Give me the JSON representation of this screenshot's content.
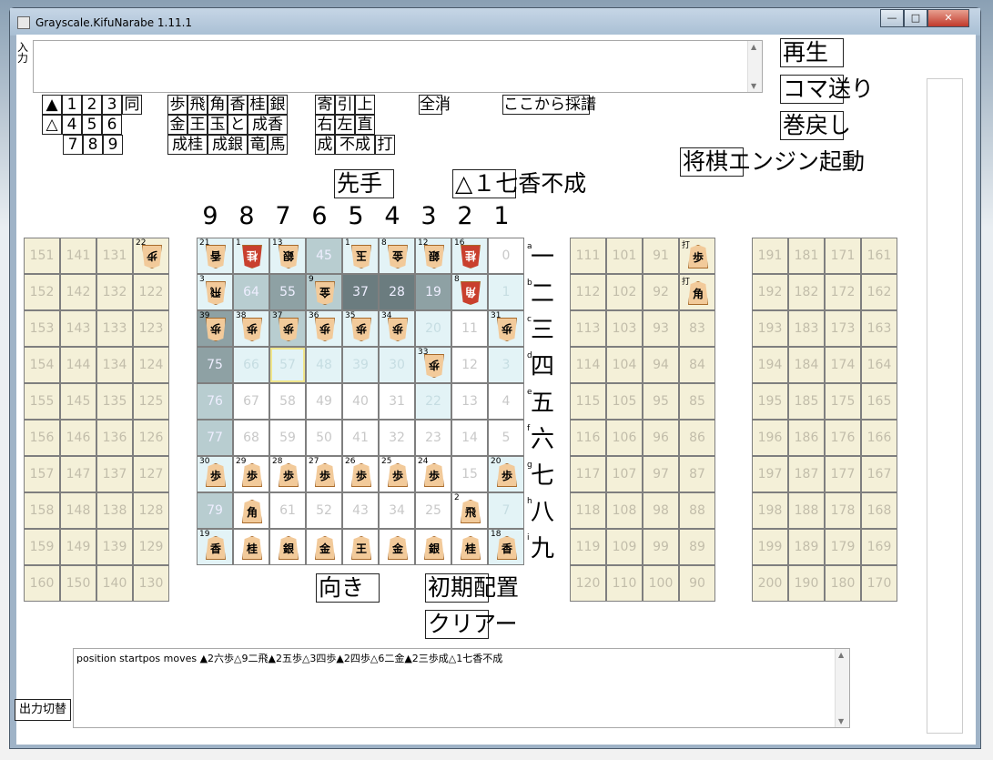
{
  "window": {
    "title": "Grayscale.KifuNarabe 1.11.1",
    "min": "—",
    "max": "□",
    "close": "✕"
  },
  "input": {
    "label": "入力",
    "value": ""
  },
  "buttons": {
    "play": "再生",
    "step": "コマ送り",
    "rewind": "巻戻し",
    "engine": "将棋エンジン起動",
    "turn": "先手",
    "move": "△１七香不成",
    "orient": "向き",
    "init": "初期配置",
    "clear": "クリアー",
    "output": "出力切替"
  },
  "keys": {
    "a": [
      "▲",
      "1",
      "2",
      "3",
      "同"
    ],
    "b": [
      "△",
      "4",
      "5",
      "6"
    ],
    "c": [
      "7",
      "8",
      "9"
    ],
    "p1": [
      "歩",
      "飛",
      "角",
      "香",
      "桂",
      "銀"
    ],
    "p2": [
      "金",
      "王",
      "玉",
      "と",
      "成香"
    ],
    "p3": [
      "成桂",
      "成銀",
      "竜",
      "馬"
    ],
    "m1": [
      "寄",
      "引",
      "上"
    ],
    "m2": [
      "右",
      "左",
      "直"
    ],
    "m3": [
      "成",
      "不成",
      "打"
    ],
    "alldel": "全消",
    "fromhere": "ここから採譜"
  },
  "columns": [
    "9",
    "8",
    "7",
    "6",
    "5",
    "4",
    "3",
    "2",
    "1"
  ],
  "rows": [
    "一",
    "二",
    "三",
    "四",
    "五",
    "六",
    "七",
    "八",
    "九"
  ],
  "rowsmall": [
    "a",
    "b",
    "c",
    "d",
    "e",
    "f",
    "g",
    "h",
    "i"
  ],
  "board": [
    [
      {
        "n": "21",
        "p": "香",
        "g": 1
      },
      {
        "n": "1",
        "p": "桂",
        "g": 1,
        "r": 1
      },
      {
        "n": "13",
        "p": "銀",
        "g": 1
      },
      {
        "n": "45"
      },
      {
        "n": "1",
        "p": "玉",
        "g": 1
      },
      {
        "n": "8",
        "p": "金",
        "g": 1
      },
      {
        "n": "12",
        "p": "銀",
        "g": 1
      },
      {
        "n": "16",
        "p": "桂",
        "g": 1,
        "r": 1
      },
      {
        "n": "0"
      }
    ],
    [
      {
        "n": "3",
        "p": "飛",
        "g": 1
      },
      {
        "n": "64"
      },
      {
        "n": "55"
      },
      {
        "n": "9",
        "p": "金",
        "g": 1
      },
      {
        "n": "37"
      },
      {
        "n": "28"
      },
      {
        "n": "19"
      },
      {
        "n": "8",
        "p": "角",
        "g": 1,
        "r": 1
      },
      {
        "n": "1"
      }
    ],
    [
      {
        "n": "39",
        "p": "歩",
        "g": 1
      },
      {
        "n": "38",
        "p": "歩",
        "g": 1
      },
      {
        "n": "37",
        "p": "歩",
        "g": 1
      },
      {
        "n": "36",
        "p": "歩",
        "g": 1
      },
      {
        "n": "35",
        "p": "歩",
        "g": 1
      },
      {
        "n": "34",
        "p": "歩",
        "g": 1
      },
      {
        "n": "20"
      },
      {
        "n": "11"
      },
      {
        "n": "31",
        "p": "歩",
        "g": 1
      }
    ],
    [
      {
        "n": "75"
      },
      {
        "n": "66"
      },
      {
        "n": "57"
      },
      {
        "n": "48"
      },
      {
        "n": "39"
      },
      {
        "n": "30"
      },
      {
        "n": "33",
        "p": "歩",
        "g": 1
      },
      {
        "n": "12"
      },
      {
        "n": "3"
      }
    ],
    [
      {
        "n": "76"
      },
      {
        "n": "67"
      },
      {
        "n": "58"
      },
      {
        "n": "49"
      },
      {
        "n": "40"
      },
      {
        "n": "31"
      },
      {
        "n": "22"
      },
      {
        "n": "13"
      },
      {
        "n": "4"
      }
    ],
    [
      {
        "n": "77"
      },
      {
        "n": "68"
      },
      {
        "n": "59"
      },
      {
        "n": "50"
      },
      {
        "n": "41"
      },
      {
        "n": "32"
      },
      {
        "n": "23"
      },
      {
        "n": "14"
      },
      {
        "n": "5"
      }
    ],
    [
      {
        "n": "30",
        "p": "歩"
      },
      {
        "n": "29",
        "p": "歩"
      },
      {
        "n": "28",
        "p": "歩"
      },
      {
        "n": "27",
        "p": "歩"
      },
      {
        "n": "26",
        "p": "歩"
      },
      {
        "n": "25",
        "p": "歩"
      },
      {
        "n": "24",
        "p": "歩"
      },
      {
        "n": "15"
      },
      {
        "n": "20",
        "p": "歩"
      }
    ],
    [
      {
        "n": "79"
      },
      {
        "n": "",
        "p": "角"
      },
      {
        "n": "61"
      },
      {
        "n": "52"
      },
      {
        "n": "43"
      },
      {
        "n": "34"
      },
      {
        "n": "25"
      },
      {
        "n": "2",
        "p": "飛"
      },
      {
        "n": "7"
      }
    ],
    [
      {
        "n": "19",
        "p": "香"
      },
      {
        "n": "",
        "p": "桂"
      },
      {
        "n": "",
        "p": "銀"
      },
      {
        "n": "",
        "p": "金"
      },
      {
        "n": "",
        "p": "王"
      },
      {
        "n": "",
        "p": "金"
      },
      {
        "n": "",
        "p": "銀"
      },
      {
        "n": "",
        "p": "桂"
      },
      {
        "n": "18",
        "p": "香"
      }
    ]
  ],
  "shade": [
    [
      "d1",
      "d1",
      "d1",
      "d2",
      "d1",
      "d1",
      "d1",
      "red",
      "d0"
    ],
    [
      "d1",
      "d2",
      "d3",
      "d2",
      "d4",
      "d4",
      "d3",
      "d1",
      "d1"
    ],
    [
      "d3",
      "d1",
      "d2",
      "d1",
      "d1",
      "d1",
      "d1",
      "d0",
      "d1"
    ],
    [
      "d3",
      "d1",
      "d1",
      "d1",
      "d1",
      "d1",
      "d1",
      "d0",
      "d1"
    ],
    [
      "d2",
      "d0",
      "d0",
      "d0",
      "d0",
      "d0",
      "d1",
      "d0",
      "d0"
    ],
    [
      "d2",
      "d0",
      "d0",
      "d0",
      "d0",
      "d0",
      "d0",
      "d0",
      "d0"
    ],
    [
      "d1",
      "d0",
      "d0",
      "d0",
      "d0",
      "d0",
      "d0",
      "d0",
      "d1"
    ],
    [
      "d2",
      "d0",
      "d0",
      "d0",
      "d0",
      "d0",
      "d0",
      "d0",
      "d1"
    ],
    [
      "d1",
      "d0",
      "d0",
      "d0",
      "d0",
      "d0",
      "d0",
      "d0",
      "d1"
    ]
  ],
  "leftStand": [
    [
      "151",
      "141",
      "131",
      "22"
    ],
    [
      "152",
      "142",
      "132",
      "122"
    ],
    [
      "153",
      "143",
      "133",
      "123"
    ],
    [
      "154",
      "144",
      "134",
      "124"
    ],
    [
      "155",
      "145",
      "135",
      "125"
    ],
    [
      "156",
      "146",
      "136",
      "126"
    ],
    [
      "157",
      "147",
      "137",
      "127"
    ],
    [
      "158",
      "148",
      "138",
      "128"
    ],
    [
      "159",
      "149",
      "139",
      "129"
    ],
    [
      "160",
      "150",
      "140",
      "130"
    ]
  ],
  "rightStand1": [
    [
      "111",
      "101",
      "91",
      "打"
    ],
    [
      "112",
      "102",
      "92",
      "打"
    ],
    [
      "113",
      "103",
      "93",
      "83"
    ],
    [
      "114",
      "104",
      "94",
      "84"
    ],
    [
      "115",
      "105",
      "95",
      "85"
    ],
    [
      "116",
      "106",
      "96",
      "86"
    ],
    [
      "117",
      "107",
      "97",
      "87"
    ],
    [
      "118",
      "108",
      "98",
      "88"
    ],
    [
      "119",
      "109",
      "99",
      "89"
    ],
    [
      "120",
      "110",
      "100",
      "90"
    ]
  ],
  "rightStand2": [
    [
      "191",
      "181",
      "171",
      "161"
    ],
    [
      "192",
      "182",
      "172",
      "162"
    ],
    [
      "193",
      "183",
      "173",
      "163"
    ],
    [
      "194",
      "184",
      "174",
      "164"
    ],
    [
      "195",
      "185",
      "175",
      "165"
    ],
    [
      "196",
      "186",
      "176",
      "166"
    ],
    [
      "197",
      "187",
      "177",
      "167"
    ],
    [
      "198",
      "188",
      "178",
      "168"
    ],
    [
      "199",
      "189",
      "179",
      "169"
    ],
    [
      "200",
      "190",
      "180",
      "170"
    ]
  ],
  "standPieces": {
    "left": "步",
    "r1a": "歩",
    "r1b": "角"
  },
  "output": {
    "text": "position startpos moves ▲2六歩△9二飛▲2五歩△3四歩▲2四歩△6二金▲2三歩成△1七香不成"
  }
}
